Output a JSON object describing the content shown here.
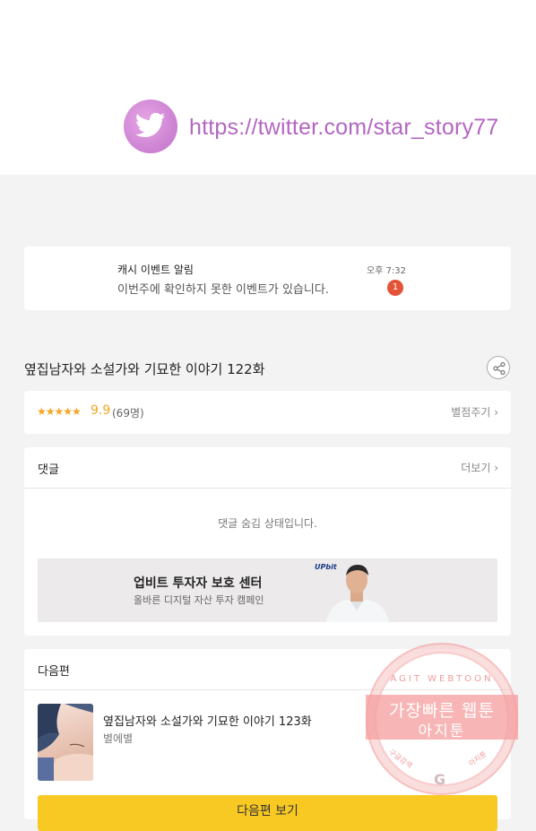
{
  "banner": {
    "twitter_url": "https://twitter.com/star_story77",
    "icon": "twitter-bird-icon",
    "accent": "#b366c2"
  },
  "notification": {
    "title": "캐시 이벤트 알림",
    "message": "이번주에 확인하지 못한 이벤트가 있습니다.",
    "time": "오후 7:32",
    "badge_count": "1",
    "badge_color": "#e55337"
  },
  "episode": {
    "title": "옆집남자와 소설가와 기묘한 이야기 122화",
    "share_icon": "share-icon"
  },
  "rating": {
    "stars": "★★★★★",
    "score": "9.9",
    "participants": "(69명)",
    "rate_link": "별점주기",
    "star_color": "#f5a623"
  },
  "comments": {
    "title": "댓글",
    "more_link": "더보기",
    "hidden_notice": "댓글 숨김 상태입니다."
  },
  "ad": {
    "title": "업비트 투자자 보호 센터",
    "subtitle": "올바른 디지털 자산 투자 캠페인",
    "logo": "UPbit"
  },
  "next_episode": {
    "section_title": "다음편",
    "title": "옆집남자와 소설가와 기묘한 이야기 123화",
    "author": "별에별",
    "button_label": "다음편 보기",
    "button_color": "#f8c823"
  },
  "watermark": {
    "ring_text": "AGIT WEBTOON",
    "main_text": "가장빠른 웹툰",
    "sub_text": "아지툰",
    "left_text": "구글검색",
    "right_text": "아지툰",
    "logo": "G"
  }
}
